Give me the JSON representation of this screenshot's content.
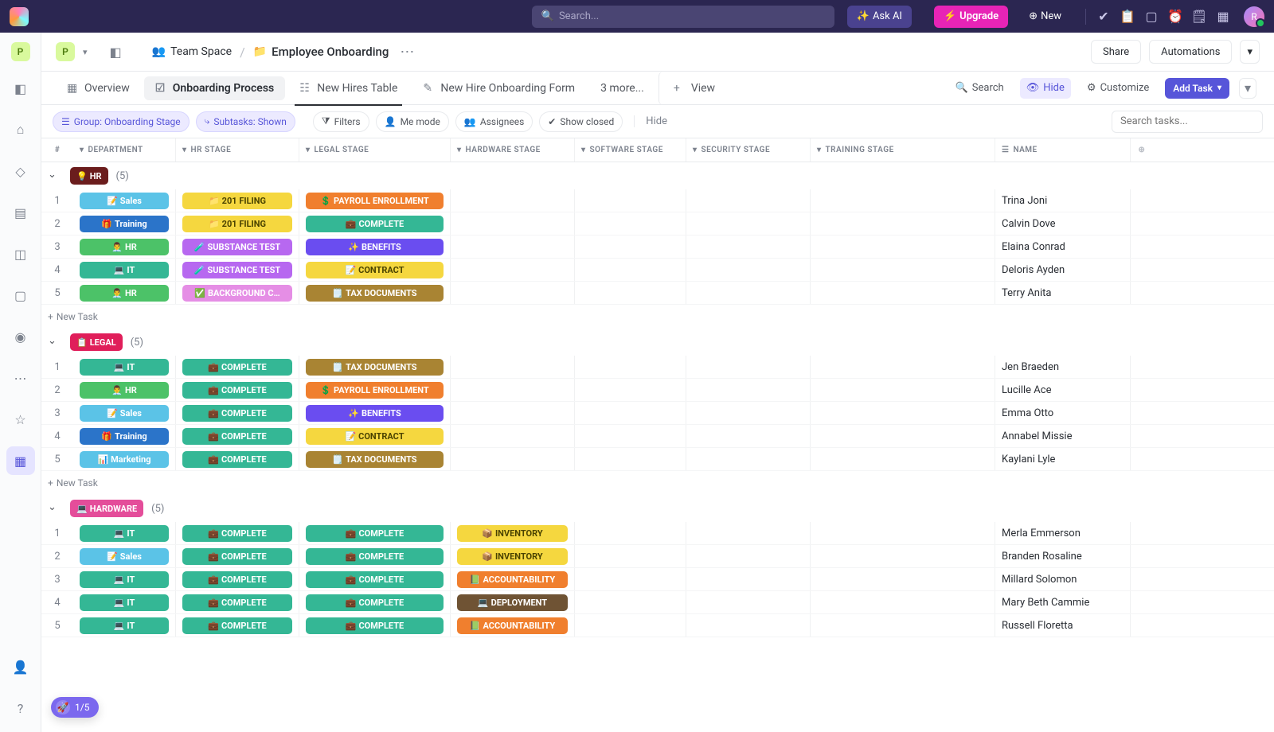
{
  "topbar": {
    "search_placeholder": "Search...",
    "ask_ai": "Ask AI",
    "upgrade": "Upgrade",
    "new": "New",
    "avatar_initial": "R"
  },
  "sidebar": {
    "workspace_initial": "P"
  },
  "header": {
    "workspace_initial": "P",
    "crumb_space": "Team Space",
    "crumb_folder": "Employee Onboarding",
    "share": "Share",
    "automations": "Automations"
  },
  "tabs": {
    "overview": "Overview",
    "process": "Onboarding Process",
    "hires": "New Hires Table",
    "form": "New Hire Onboarding Form",
    "more": "3 more...",
    "view": "View",
    "search": "Search",
    "hide": "Hide",
    "customize": "Customize",
    "add_task": "Add Task"
  },
  "filters": {
    "group": "Group: Onboarding Stage",
    "subtasks": "Subtasks: Shown",
    "filters": "Filters",
    "me_mode": "Me mode",
    "assignees": "Assignees",
    "show_closed": "Show closed",
    "hide": "Hide",
    "search_placeholder": "Search tasks..."
  },
  "columns": [
    "#",
    "DEPARTMENT",
    "HR STAGE",
    "LEGAL STAGE",
    "HARDWARE STAGE",
    "SOFTWARE STAGE",
    "SECURITY STAGE",
    "TRAINING STAGE",
    "NAME"
  ],
  "new_task_label": "New Task",
  "progress": "1/5",
  "groups": [
    {
      "id": "hr",
      "label": "HR",
      "emoji": "💡",
      "color": "#6b1d1d",
      "count": "(5)",
      "rows": [
        {
          "num": "1",
          "dept": {
            "t": "Sales",
            "e": "📝",
            "c": "#5bc3e7"
          },
          "hr": {
            "t": "201 FILING",
            "e": "📁",
            "c": "#f5d73f",
            "fg": "#4a4300"
          },
          "legal": {
            "t": "PAYROLL ENROLLMENT",
            "e": "💲",
            "c": "#f07f2e"
          },
          "hw": null,
          "name": "Trina Joni"
        },
        {
          "num": "2",
          "dept": {
            "t": "Training",
            "e": "🎁",
            "c": "#2b74c9"
          },
          "hr": {
            "t": "201 FILING",
            "e": "📁",
            "c": "#f5d73f",
            "fg": "#4a4300"
          },
          "legal": {
            "t": "COMPLETE",
            "e": "💼",
            "c": "#34b795"
          },
          "hw": null,
          "name": "Calvin Dove"
        },
        {
          "num": "3",
          "dept": {
            "t": "HR",
            "e": "👨‍💼",
            "c": "#4cc268"
          },
          "hr": {
            "t": "SUBSTANCE TEST",
            "e": "🧪",
            "c": "#b768f0"
          },
          "legal": {
            "t": "BENEFITS",
            "e": "✨",
            "c": "#6a4df0"
          },
          "hw": null,
          "name": "Elaina Conrad"
        },
        {
          "num": "4",
          "dept": {
            "t": "IT",
            "e": "💻",
            "c": "#34b795"
          },
          "hr": {
            "t": "SUBSTANCE TEST",
            "e": "🧪",
            "c": "#b768f0"
          },
          "legal": {
            "t": "CONTRACT",
            "e": "📝",
            "c": "#f5d73f",
            "fg": "#4a4300"
          },
          "hw": null,
          "name": "Deloris Ayden"
        },
        {
          "num": "5",
          "dept": {
            "t": "HR",
            "e": "👨‍💼",
            "c": "#4cc268"
          },
          "hr": {
            "t": "BACKGROUND C…",
            "e": "✅",
            "c": "#e58ee5"
          },
          "legal": {
            "t": "TAX DOCUMENTS",
            "e": "🗒️",
            "c": "#a98433"
          },
          "hw": null,
          "name": "Terry Anita"
        }
      ]
    },
    {
      "id": "legal",
      "label": "LEGAL",
      "emoji": "📋",
      "color": "#e01e5a",
      "count": "(5)",
      "rows": [
        {
          "num": "1",
          "dept": {
            "t": "IT",
            "e": "💻",
            "c": "#34b795"
          },
          "hr": {
            "t": "COMPLETE",
            "e": "💼",
            "c": "#34b795"
          },
          "legal": {
            "t": "TAX DOCUMENTS",
            "e": "🗒️",
            "c": "#a98433"
          },
          "hw": null,
          "name": "Jen Braeden"
        },
        {
          "num": "2",
          "dept": {
            "t": "HR",
            "e": "👨‍💼",
            "c": "#4cc268"
          },
          "hr": {
            "t": "COMPLETE",
            "e": "💼",
            "c": "#34b795"
          },
          "legal": {
            "t": "PAYROLL ENROLLMENT",
            "e": "💲",
            "c": "#f07f2e"
          },
          "hw": null,
          "name": "Lucille Ace"
        },
        {
          "num": "3",
          "dept": {
            "t": "Sales",
            "e": "📝",
            "c": "#5bc3e7"
          },
          "hr": {
            "t": "COMPLETE",
            "e": "💼",
            "c": "#34b795"
          },
          "legal": {
            "t": "BENEFITS",
            "e": "✨",
            "c": "#6a4df0"
          },
          "hw": null,
          "name": "Emma Otto"
        },
        {
          "num": "4",
          "dept": {
            "t": "Training",
            "e": "🎁",
            "c": "#2b74c9"
          },
          "hr": {
            "t": "COMPLETE",
            "e": "💼",
            "c": "#34b795"
          },
          "legal": {
            "t": "CONTRACT",
            "e": "📝",
            "c": "#f5d73f",
            "fg": "#4a4300"
          },
          "hw": null,
          "name": "Annabel Missie"
        },
        {
          "num": "5",
          "dept": {
            "t": "Marketing",
            "e": "📊",
            "c": "#5bc3e7"
          },
          "hr": {
            "t": "COMPLETE",
            "e": "💼",
            "c": "#34b795"
          },
          "legal": {
            "t": "TAX DOCUMENTS",
            "e": "🗒️",
            "c": "#a98433"
          },
          "hw": null,
          "name": "Kaylani Lyle"
        }
      ]
    },
    {
      "id": "hardware",
      "label": "HARDWARE",
      "emoji": "💻",
      "color": "#e44d9a",
      "count": "(5)",
      "rows": [
        {
          "num": "1",
          "dept": {
            "t": "IT",
            "e": "💻",
            "c": "#34b795"
          },
          "hr": {
            "t": "COMPLETE",
            "e": "💼",
            "c": "#34b795"
          },
          "legal": {
            "t": "COMPLETE",
            "e": "💼",
            "c": "#34b795"
          },
          "hw": {
            "t": "INVENTORY",
            "e": "📦",
            "c": "#f5d73f",
            "fg": "#4a4300"
          },
          "name": "Merla Emmerson"
        },
        {
          "num": "2",
          "dept": {
            "t": "Sales",
            "e": "📝",
            "c": "#5bc3e7"
          },
          "hr": {
            "t": "COMPLETE",
            "e": "💼",
            "c": "#34b795"
          },
          "legal": {
            "t": "COMPLETE",
            "e": "💼",
            "c": "#34b795"
          },
          "hw": {
            "t": "INVENTORY",
            "e": "📦",
            "c": "#f5d73f",
            "fg": "#4a4300"
          },
          "name": "Branden Rosaline"
        },
        {
          "num": "3",
          "dept": {
            "t": "IT",
            "e": "💻",
            "c": "#34b795"
          },
          "hr": {
            "t": "COMPLETE",
            "e": "💼",
            "c": "#34b795"
          },
          "legal": {
            "t": "COMPLETE",
            "e": "💼",
            "c": "#34b795"
          },
          "hw": {
            "t": "ACCOUNTABILITY",
            "e": "📗",
            "c": "#f07f2e"
          },
          "name": "Millard Solomon"
        },
        {
          "num": "4",
          "dept": {
            "t": "IT",
            "e": "💻",
            "c": "#34b795"
          },
          "hr": {
            "t": "COMPLETE",
            "e": "💼",
            "c": "#34b795"
          },
          "legal": {
            "t": "COMPLETE",
            "e": "💼",
            "c": "#34b795"
          },
          "hw": {
            "t": "DEPLOYMENT",
            "e": "💻",
            "c": "#6f5334"
          },
          "name": "Mary Beth Cammie"
        },
        {
          "num": "5",
          "dept": {
            "t": "IT",
            "e": "💻",
            "c": "#34b795"
          },
          "hr": {
            "t": "COMPLETE",
            "e": "💼",
            "c": "#34b795"
          },
          "legal": {
            "t": "COMPLETE",
            "e": "💼",
            "c": "#34b795"
          },
          "hw": {
            "t": "ACCOUNTABILITY",
            "e": "📗",
            "c": "#f07f2e"
          },
          "name": "Russell Floretta"
        }
      ]
    }
  ]
}
